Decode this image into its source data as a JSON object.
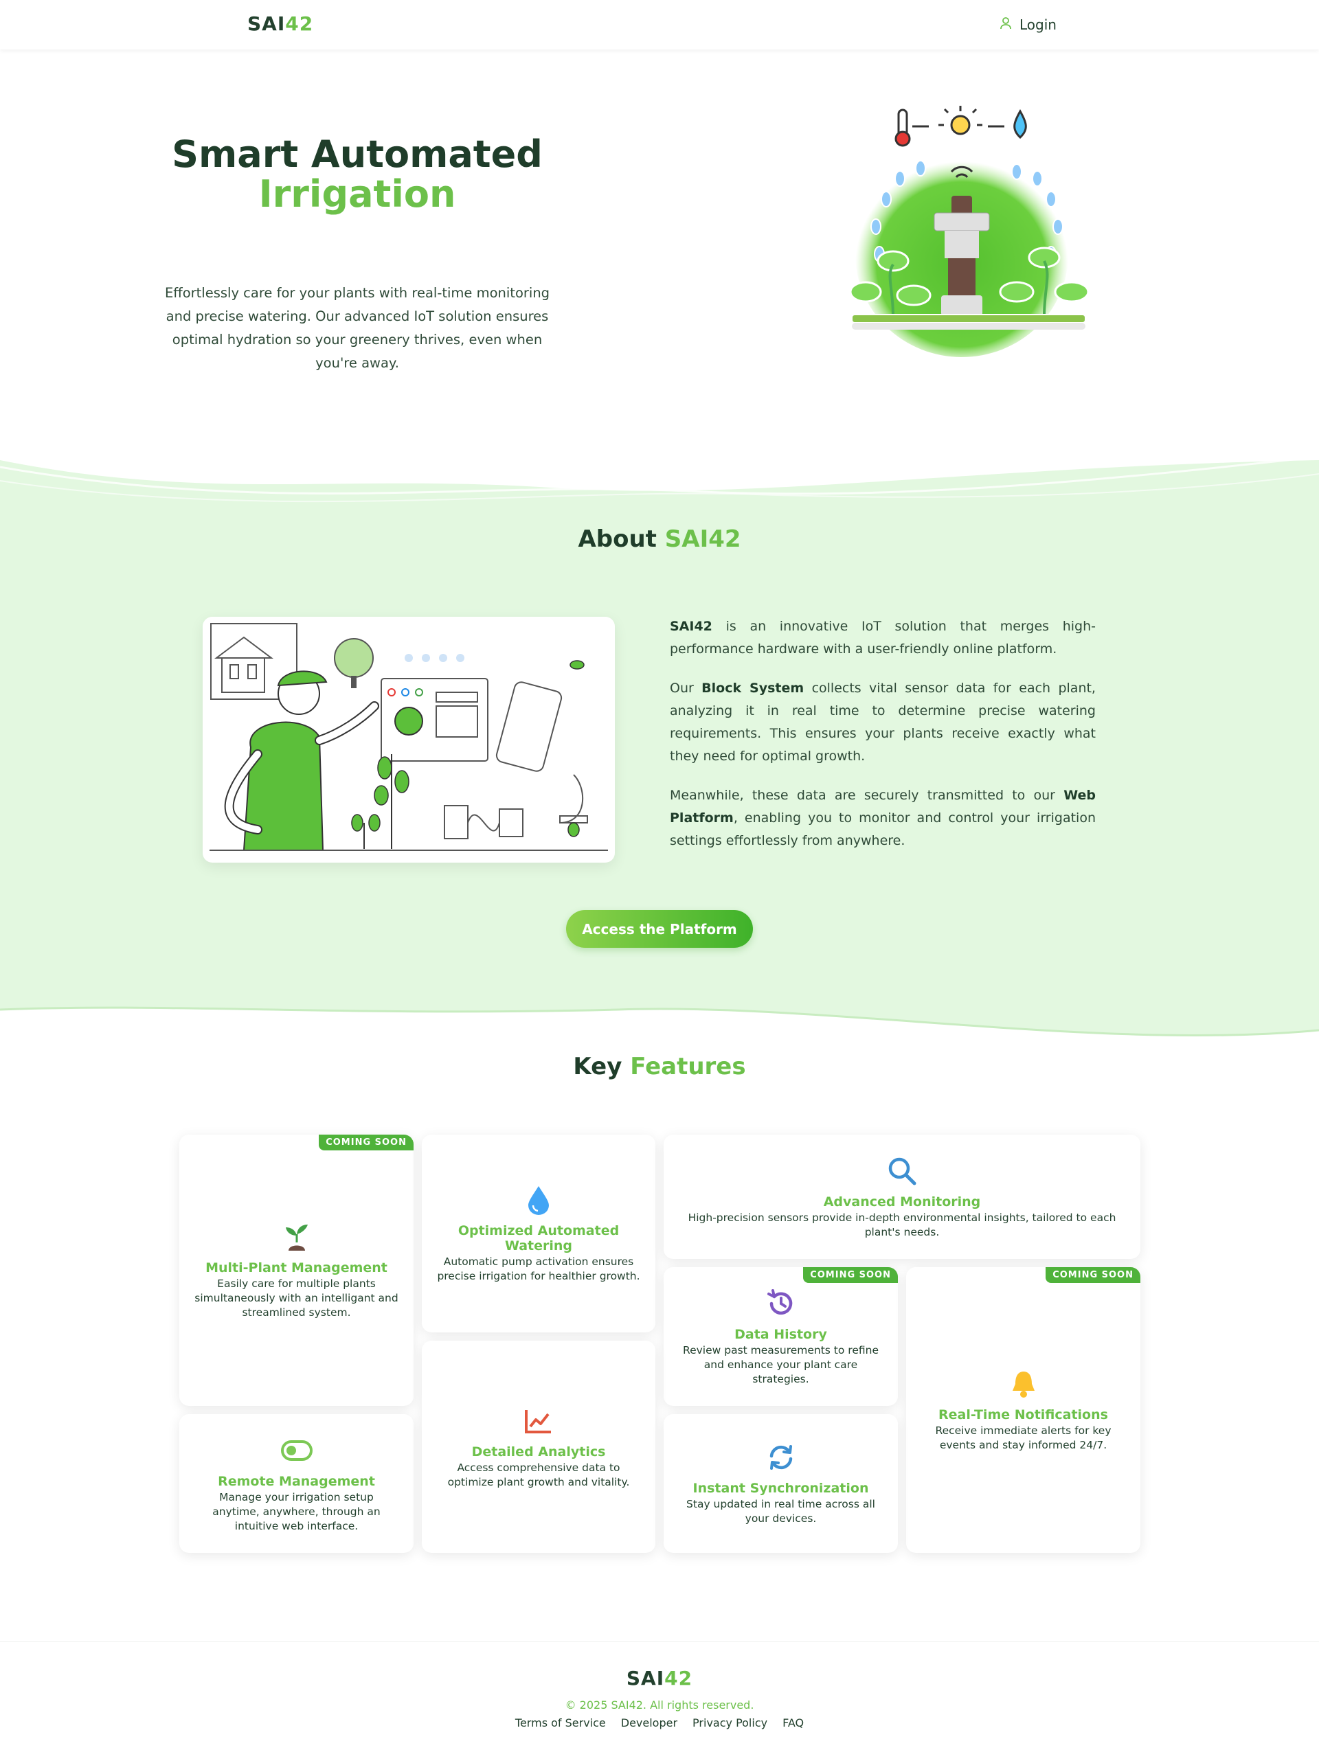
{
  "header": {
    "logo_main": "SAI",
    "logo_accent": "42",
    "login_label": "Login",
    "login_icon": "user-icon"
  },
  "hero": {
    "title_line1": "Smart Automated",
    "title_line2": "Irrigation",
    "description": "Effortlessly care for your plants with real-time monitoring and precise watering. Our advanced IoT solution ensures optimal hydration so your greenery thrives, even when you're away."
  },
  "about": {
    "title_main": "About ",
    "title_accent": "SAI42",
    "p1_bold": "SAI42",
    "p1_rest": " is an innovative IoT solution that merges high-performance hardware with a user-friendly online platform.",
    "p2_pre": "Our ",
    "p2_bold": "Block System",
    "p2_rest": " collects vital sensor data for each plant, analyzing it in real time to determine precise watering requirements. This ensures your plants receive exactly what they need for optimal growth.",
    "p3_pre": "Meanwhile, these data are securely transmitted to our ",
    "p3_bold": "Web Platform",
    "p3_rest": ", enabling you to monitor and control your irrigation settings effortlessly from anywhere.",
    "cta_label": "Access the Platform"
  },
  "features": {
    "title_main": "Key ",
    "title_accent": "Features",
    "badge_label": "COMING SOON",
    "items": [
      {
        "title": "Multi-Plant Management",
        "desc": "Easily care for multiple plants simultaneously with an intelligant and streamlined system.",
        "icon": "seedling-icon",
        "coming_soon": true
      },
      {
        "title": "Optimized Automated Watering",
        "desc": "Automatic pump activation ensures precise irrigation for healthier growth.",
        "icon": "water-drop-icon",
        "coming_soon": false
      },
      {
        "title": "Advanced Monitoring",
        "desc": "High-precision sensors provide in-depth environmental insights, tailored to each plant's needs.",
        "icon": "search-icon",
        "coming_soon": false
      },
      {
        "title": "Data History",
        "desc": "Review past measurements to refine and enhance your plant care strategies.",
        "icon": "history-icon",
        "coming_soon": true
      },
      {
        "title": "Real-Time Notifications",
        "desc": "Receive immediate alerts for key events and stay informed 24/7.",
        "icon": "bell-icon",
        "coming_soon": true
      },
      {
        "title": "Remote Management",
        "desc": "Manage your irrigation setup anytime, anywhere, through an intuitive web interface.",
        "icon": "toggle-icon",
        "coming_soon": false
      },
      {
        "title": "Detailed Analytics",
        "desc": "Access comprehensive data to optimize plant growth and vitality.",
        "icon": "chart-line-icon",
        "coming_soon": false
      },
      {
        "title": "Instant Synchronization",
        "desc": "Stay updated in real time across all your devices.",
        "icon": "sync-icon",
        "coming_soon": false
      }
    ]
  },
  "footer": {
    "logo_main": "SAI",
    "logo_accent": "42",
    "copyright": "© 2025 SAI42. All rights reserved.",
    "links": [
      "Terms of Service",
      "Developer",
      "Privacy Policy",
      "FAQ"
    ]
  },
  "colors": {
    "accent": "#6cc04a",
    "dark_text": "#1f3d2a",
    "about_bg": "#e3f8e0",
    "badge": "#4fb23a"
  }
}
